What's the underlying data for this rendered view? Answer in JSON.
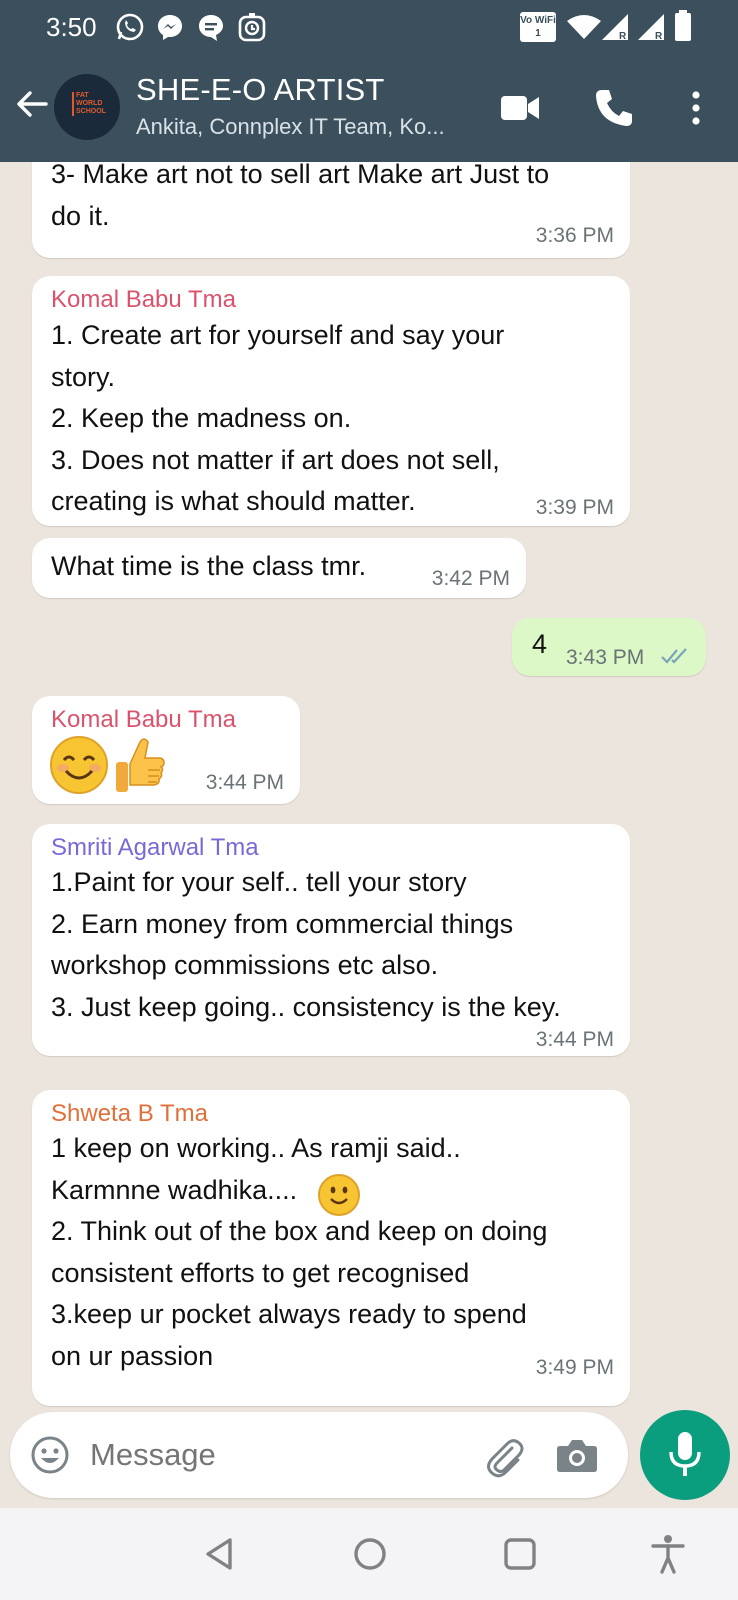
{
  "status_bar": {
    "time": "3:50",
    "network_label": "Vo WiFi 1",
    "left_icons": [
      "whatsapp-icon",
      "messenger-icon",
      "chat-icon",
      "timer-icon"
    ],
    "right_icons": [
      "wifi-icon",
      "signal-icon",
      "signal-icon",
      "battery-icon"
    ]
  },
  "header": {
    "title": "SHE-E-O ARTIST",
    "subtitle": "Ankita, Connplex IT Team, Ko...",
    "avatar_text": "FAT WORLD SCHOOL",
    "icons": [
      "back-arrow-icon",
      "video-call-icon",
      "phone-icon",
      "more-options-icon"
    ]
  },
  "messages": [
    {
      "direction": "in",
      "sender": "",
      "text": "3- Make art not to sell art Make art Just to\ndo it.",
      "time": "3:36 PM"
    },
    {
      "direction": "in",
      "sender": "Komal Babu Tma",
      "sender_color": "#d9536c",
      "text": "1. Create art for yourself and say your\nstory.\n2. Keep the madness on.\n3. Does not matter if art does not sell,\ncreating is what should matter.",
      "time": "3:39 PM"
    },
    {
      "direction": "in",
      "sender": "",
      "text": "What time is the class tmr.",
      "time": "3:42 PM"
    },
    {
      "direction": "out",
      "text": "4",
      "time": "3:43 PM",
      "status": "read-ticks-icon"
    },
    {
      "direction": "in",
      "sender": "Komal Babu Tma",
      "sender_color": "#d9536c",
      "emojis": [
        "smiling-face-emoji",
        "thumbs-up-emoji"
      ],
      "time": "3:44 PM"
    },
    {
      "direction": "in",
      "sender": "Smriti Agarwal Tma",
      "sender_color": "#7b68d6",
      "text": "1.Paint for your self.. tell your story\n2. Earn money from commercial things\nworkshop commissions etc also.\n3. Just keep going.. consistency is the key.",
      "time": "3:44 PM"
    },
    {
      "direction": "in",
      "sender": "Shweta B Tma",
      "sender_color": "#e0703a",
      "text_before_emoji": "1 keep on working.. As ramji said..\nKarmnne wadhika....",
      "emoji": "slightly-smiling-face-emoji",
      "text_after_emoji": "2. Think out of the box and keep on doing\nconsistent efforts to get recognised\n3.keep ur pocket always ready to spend\non ur passion",
      "time": "3:49 PM"
    }
  ],
  "input": {
    "placeholder": "Message",
    "icons": [
      "emoji-icon",
      "attach-icon",
      "camera-icon",
      "mic-icon"
    ]
  },
  "nav_bar": {
    "icons": [
      "back-nav-icon",
      "home-nav-icon",
      "recents-nav-icon",
      "accessibility-icon"
    ]
  },
  "colors": {
    "header_bg": "#3b4f5c",
    "chat_bg": "#ece5dd",
    "incoming_bubble": "#ffffff",
    "outgoing_bubble": "#dcf8c6",
    "mic_button": "#0a9e7f",
    "read_ticks": "#7aa5b8"
  }
}
